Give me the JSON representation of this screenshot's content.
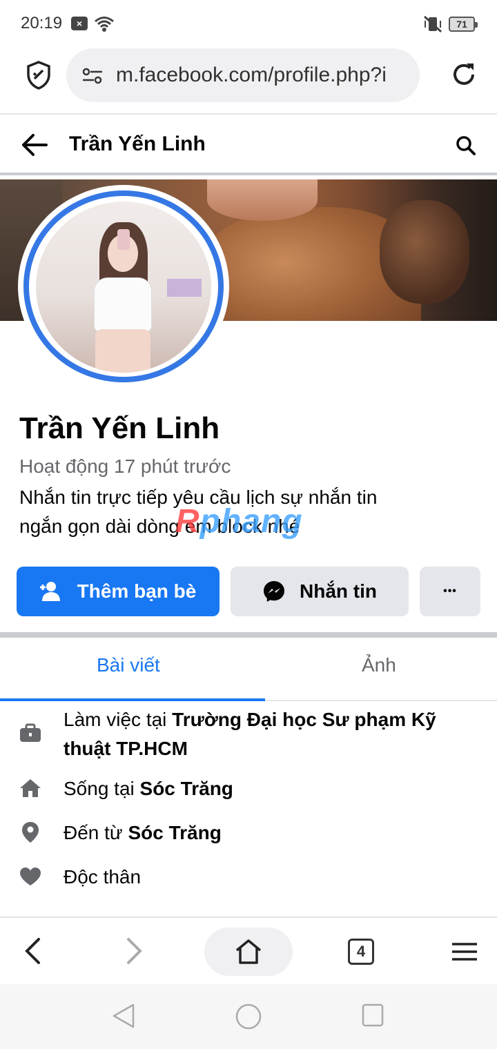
{
  "status_bar": {
    "time": "20:19",
    "notification_badge": "×",
    "battery": "71"
  },
  "browser": {
    "url": "m.facebook.com/profile.php?i",
    "tab_count": "4"
  },
  "header": {
    "title": "Trần Yến Linh"
  },
  "profile": {
    "name": "Trần Yến Linh",
    "active_status": "Hoạt động 17 phút trước",
    "bio_line1": "Nhắn tin trực tiếp yêu cầu lịch sự nhắn tin",
    "bio_line2": "ngắn gọn dài dòng em block nhé"
  },
  "watermark": {
    "first": "R",
    "rest": "phang"
  },
  "actions": {
    "add_friend": "Thêm bạn bè",
    "message": "Nhắn tin",
    "more": "•••"
  },
  "tabs": [
    {
      "label": "Bài viết",
      "active": true
    },
    {
      "label": "Ảnh",
      "active": false
    }
  ],
  "intro": {
    "work_prefix": "Làm việc tại ",
    "work_place": "Trường Đại học Sư phạm Kỹ thuật TP.HCM",
    "lives_prefix": "Sống tại ",
    "lives_place": "Sóc Trăng",
    "from_prefix": "Đến từ ",
    "from_place": "Sóc Trăng",
    "relationship": "Độc thân"
  },
  "colors": {
    "accent": "#1877f2",
    "secondary_button": "#e4e6eb",
    "muted_text": "#65676b"
  }
}
